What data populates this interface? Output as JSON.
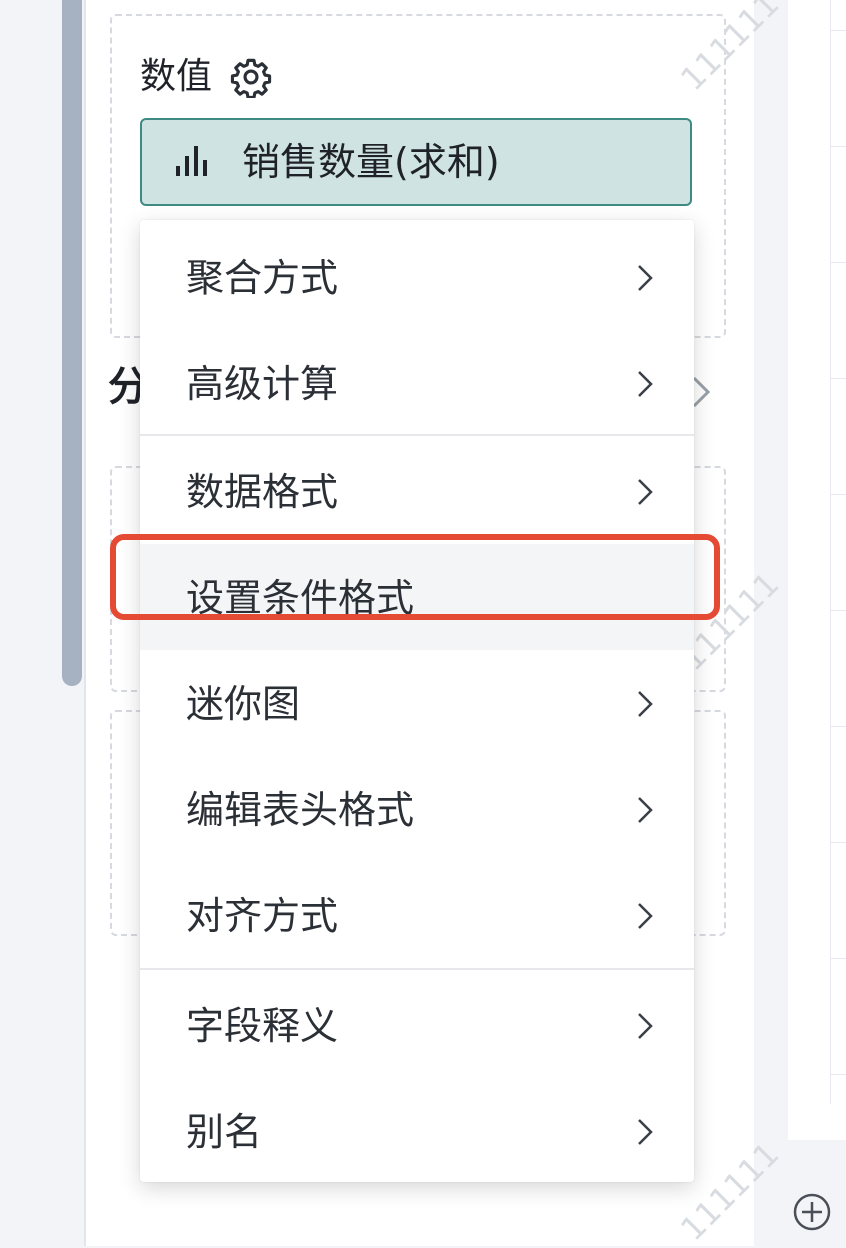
{
  "values_zone": {
    "title": "数值",
    "field_pill": {
      "label": "销售数量(求和)",
      "icon": "bar-chart-icon"
    }
  },
  "section": {
    "title_partial": "分"
  },
  "watermark": "111111",
  "context_menu": {
    "items": [
      {
        "label": "聚合方式",
        "has_submenu": true
      },
      {
        "label": "高级计算",
        "has_submenu": true
      },
      {
        "label": "数据格式",
        "has_submenu": true
      },
      {
        "label": "设置条件格式",
        "has_submenu": false,
        "hovered": true,
        "highlighted": true
      },
      {
        "label": "迷你图",
        "has_submenu": true
      },
      {
        "label": "编辑表头格式",
        "has_submenu": true
      },
      {
        "label": "对齐方式",
        "has_submenu": true
      },
      {
        "label": "字段释义",
        "has_submenu": true
      },
      {
        "label": "别名",
        "has_submenu": true
      }
    ]
  },
  "colors": {
    "pill_bg": "#cfe3e2",
    "pill_border": "#3f8a84",
    "highlight": "#e54a34",
    "scrollbar": "#a6b1c2"
  }
}
